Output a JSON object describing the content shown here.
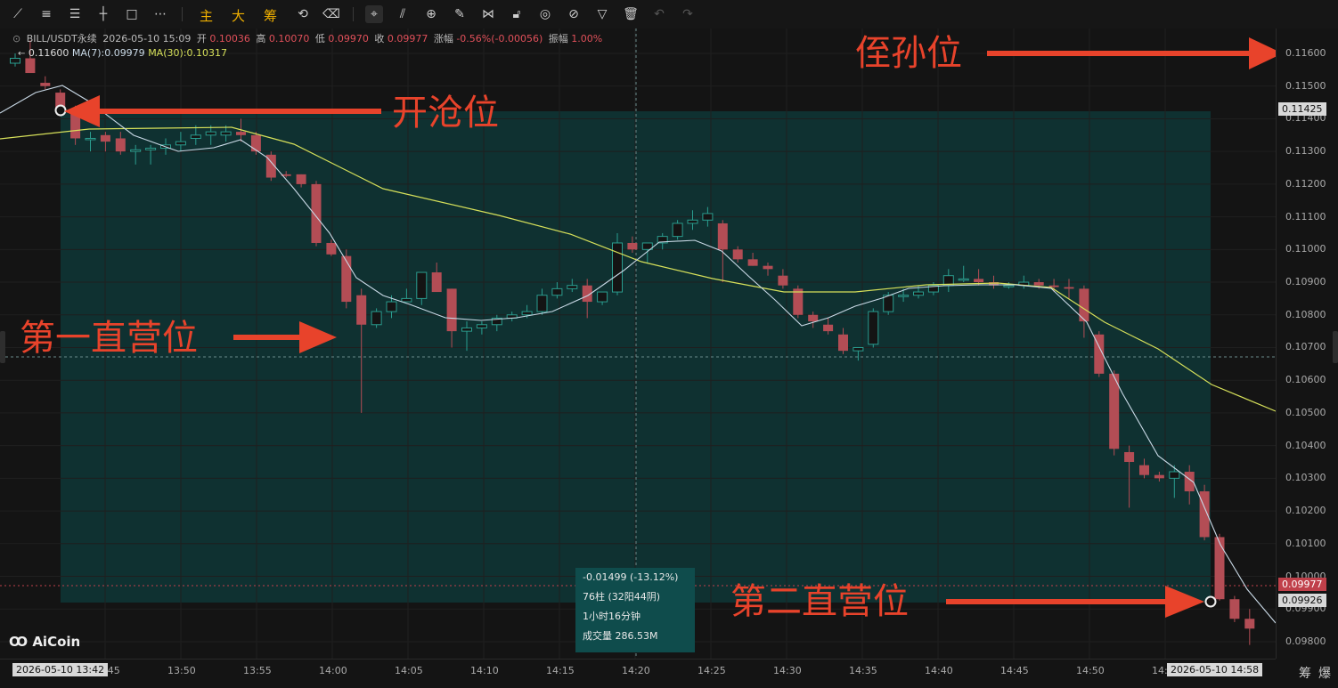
{
  "toolbar": {
    "icons": [
      "line-tool-icon",
      "parallel-line-icon",
      "multi-line-icon",
      "horizontal-line-icon",
      "rectangle-icon",
      "more-icon"
    ],
    "text_buttons": [
      "主",
      "大",
      "筹"
    ],
    "right_icons": [
      "magnet-icon",
      "measure-ruler-icon",
      "zoom-icon",
      "brush-icon",
      "pattern-icon",
      "lock-icon",
      "eye-link-icon",
      "filter-icon",
      "trash-icon",
      "undo-icon",
      "redo-icon"
    ]
  },
  "info": {
    "symbol": "BILL/USDT永续",
    "datetime": "2026-05-10 15:09",
    "open_label": "开",
    "open": "0.10036",
    "high_label": "高",
    "high": "0.10070",
    "low_label": "低",
    "low": "0.09970",
    "close_label": "收",
    "close": "0.09977",
    "change_label": "涨幅",
    "change": "-0.56%(-0.00056)",
    "amp_label": "振幅",
    "amp": "1.00%"
  },
  "ma": {
    "ma7_label": "MA(7):0.09979",
    "ma30_label": "MA(30):0.10317",
    "ma7_color": "#c9d9e6",
    "ma30_color": "#d6e05a",
    "overlay_price": "0.11600"
  },
  "colors": {
    "up": "#2a9d8f",
    "down": "#b34d55",
    "measure": "#0f4c4c",
    "annotation": "#e8432b"
  },
  "price_axis": {
    "ticks": [
      "0.11600",
      "0.11500",
      "0.11400",
      "0.11300",
      "0.11200",
      "0.11100",
      "0.11000",
      "0.10900",
      "0.10800",
      "0.10700",
      "0.10600",
      "0.10500",
      "0.10400",
      "0.10300",
      "0.10200",
      "0.10100",
      "0.10000",
      "0.09900",
      "0.09800"
    ],
    "tag_entry": "0.11425",
    "tag_last": "0.09977",
    "tag_low": "0.09926"
  },
  "time_axis": {
    "ticks": [
      "13:45",
      "13:50",
      "13:55",
      "14:00",
      "14:05",
      "14:10",
      "14:15",
      "14:20",
      "14:25",
      "14:30",
      "14:35",
      "14:40",
      "14:45",
      "14:50",
      "14:55"
    ],
    "start_tag": "2026-05-10 13:42",
    "end_tag": "2026-05-10 14:58"
  },
  "measure": {
    "change": "-0.01499 (-13.12%)",
    "bars": "76柱 (32阳44阴)",
    "duration": "1小时16分钟",
    "volume": "成交量 286.53M"
  },
  "annotations": {
    "stop": "侄孙位",
    "entry": "开沧位",
    "first_add": "第一直营位",
    "second_add": "第二直营位"
  },
  "logo": "AiCoin",
  "corner": {
    "chips": "筹",
    "explode": "爆"
  },
  "chart_data": {
    "type": "candlestick",
    "title": "BILL/USDT永续",
    "xlabel": "",
    "ylabel": "",
    "ylim": [
      0.0975,
      0.1166
    ],
    "interval_minutes": 1,
    "x_start": "13:42",
    "series": [
      {
        "name": "MA(7)",
        "type": "line"
      },
      {
        "name": "MA(30)",
        "type": "line"
      }
    ],
    "ohlc": [
      [
        0.1157,
        0.116,
        0.1156,
        0.11585
      ],
      [
        0.11585,
        0.1164,
        0.1154,
        0.1154
      ],
      [
        0.1151,
        0.1153,
        0.1149,
        0.115
      ],
      [
        0.1148,
        0.1149,
        0.1142,
        0.1143
      ],
      [
        0.1143,
        0.1144,
        0.1132,
        0.1134
      ],
      [
        0.1134,
        0.1136,
        0.113,
        0.1134
      ],
      [
        0.1135,
        0.1136,
        0.113,
        0.1133
      ],
      [
        0.1134,
        0.1136,
        0.1129,
        0.113
      ],
      [
        0.113,
        0.1132,
        0.1126,
        0.11305
      ],
      [
        0.11305,
        0.1132,
        0.1126,
        0.1131
      ],
      [
        0.1131,
        0.1134,
        0.1129,
        0.1132
      ],
      [
        0.1132,
        0.1136,
        0.113,
        0.1133
      ],
      [
        0.1134,
        0.1138,
        0.1132,
        0.1135
      ],
      [
        0.1135,
        0.1138,
        0.1132,
        0.1136
      ],
      [
        0.1135,
        0.1138,
        0.1133,
        0.1136
      ],
      [
        0.1136,
        0.114,
        0.1133,
        0.1135
      ],
      [
        0.1135,
        0.1136,
        0.1129,
        0.113
      ],
      [
        0.1129,
        0.113,
        0.1121,
        0.1122
      ],
      [
        0.1123,
        0.1124,
        0.1122,
        0.11225
      ],
      [
        0.1123,
        0.1123,
        0.1119,
        0.112
      ],
      [
        0.112,
        0.1121,
        0.1101,
        0.1102
      ],
      [
        0.1102,
        0.1103,
        0.1098,
        0.10985
      ],
      [
        0.1098,
        0.11,
        0.1082,
        0.1084
      ],
      [
        0.1086,
        0.1088,
        0.105,
        0.1077
      ],
      [
        0.1077,
        0.1082,
        0.1076,
        0.1081
      ],
      [
        0.1081,
        0.1086,
        0.1079,
        0.1084
      ],
      [
        0.1084,
        0.1088,
        0.1084,
        0.1085
      ],
      [
        0.1085,
        0.1093,
        0.1083,
        0.1093
      ],
      [
        0.1093,
        0.1096,
        0.109,
        0.1087
      ],
      [
        0.1088,
        0.1088,
        0.107,
        0.1075
      ],
      [
        0.1075,
        0.1078,
        0.1069,
        0.1076
      ],
      [
        0.1076,
        0.1078,
        0.1074,
        0.1077
      ],
      [
        0.1077,
        0.108,
        0.1075,
        0.1079
      ],
      [
        0.1079,
        0.1081,
        0.1078,
        0.108
      ],
      [
        0.108,
        0.1083,
        0.1079,
        0.1081
      ],
      [
        0.1081,
        0.1088,
        0.108,
        0.1086
      ],
      [
        0.1086,
        0.109,
        0.1085,
        0.1088
      ],
      [
        0.1088,
        0.1091,
        0.1087,
        0.1089
      ],
      [
        0.1089,
        0.1091,
        0.1079,
        0.1084
      ],
      [
        0.1084,
        0.1087,
        0.1083,
        0.1087
      ],
      [
        0.1087,
        0.1105,
        0.1086,
        0.1102
      ],
      [
        0.1102,
        0.1104,
        0.1099,
        0.11
      ],
      [
        0.11,
        0.1102,
        0.1096,
        0.1102
      ],
      [
        0.1102,
        0.1105,
        0.11,
        0.1104
      ],
      [
        0.1104,
        0.1109,
        0.1103,
        0.1108
      ],
      [
        0.1108,
        0.1112,
        0.1106,
        0.1109
      ],
      [
        0.1109,
        0.1113,
        0.1107,
        0.1111
      ],
      [
        0.1108,
        0.1109,
        0.109,
        0.11
      ],
      [
        0.11,
        0.1101,
        0.1096,
        0.1097
      ],
      [
        0.1097,
        0.1099,
        0.1095,
        0.1095
      ],
      [
        0.1095,
        0.1096,
        0.1092,
        0.1094
      ],
      [
        0.1092,
        0.1094,
        0.1088,
        0.1089
      ],
      [
        0.1088,
        0.1089,
        0.1079,
        0.108
      ],
      [
        0.108,
        0.1081,
        0.1076,
        0.1078
      ],
      [
        0.1077,
        0.1079,
        0.1074,
        0.1075
      ],
      [
        0.1074,
        0.1076,
        0.1068,
        0.1069
      ],
      [
        0.1069,
        0.107,
        0.1066,
        0.107
      ],
      [
        0.1071,
        0.1082,
        0.107,
        0.1081
      ],
      [
        0.1081,
        0.1087,
        0.108,
        0.1086
      ],
      [
        0.1086,
        0.1088,
        0.1084,
        0.1086
      ],
      [
        0.1086,
        0.1089,
        0.1085,
        0.1087
      ],
      [
        0.1087,
        0.109,
        0.1086,
        0.1089
      ],
      [
        0.1089,
        0.1094,
        0.1087,
        0.1092
      ],
      [
        0.1091,
        0.1095,
        0.109,
        0.1091
      ],
      [
        0.1091,
        0.1094,
        0.1089,
        0.109
      ],
      [
        0.109,
        0.1092,
        0.1088,
        0.1089
      ],
      [
        0.1089,
        0.109,
        0.1088,
        0.1089
      ],
      [
        0.1089,
        0.1092,
        0.1088,
        0.109
      ],
      [
        0.109,
        0.1091,
        0.1088,
        0.1089
      ],
      [
        0.1089,
        0.1091,
        0.1087,
        0.10885
      ],
      [
        0.10885,
        0.1091,
        0.1085,
        0.1088
      ],
      [
        0.1088,
        0.1089,
        0.1073,
        0.1078
      ],
      [
        0.1074,
        0.1075,
        0.1061,
        0.1062
      ],
      [
        0.1062,
        0.1063,
        0.1037,
        0.1039
      ],
      [
        0.1038,
        0.104,
        0.1021,
        0.1035
      ],
      [
        0.1034,
        0.1036,
        0.103,
        0.1031
      ],
      [
        0.1031,
        0.1032,
        0.1029,
        0.103
      ],
      [
        0.103,
        0.1034,
        0.1024,
        0.1032
      ],
      [
        0.1032,
        0.1034,
        0.1022,
        0.1026
      ],
      [
        0.1026,
        0.1028,
        0.1011,
        0.1012
      ],
      [
        0.1012,
        0.1013,
        0.09926,
        0.0993
      ],
      [
        0.0993,
        0.0994,
        0.0986,
        0.0987
      ],
      [
        0.0987,
        0.099,
        0.0979,
        0.0984
      ]
    ]
  }
}
